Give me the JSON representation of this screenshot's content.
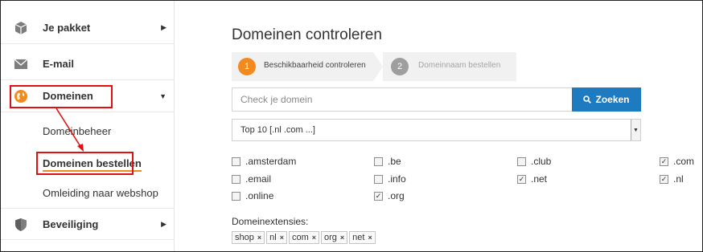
{
  "sidebar": {
    "items": [
      {
        "label": "Je pakket",
        "icon": "package-icon"
      },
      {
        "label": "E-mail",
        "icon": "envelope-icon"
      },
      {
        "label": "Domeinen",
        "icon": "globe-icon"
      },
      {
        "label": "Beveiliging",
        "icon": "shield-icon"
      }
    ],
    "sub_items": [
      {
        "label": "Domeinbeheer"
      },
      {
        "label": "Domeinen bestellen"
      },
      {
        "label": "Omleiding naar webshop"
      }
    ]
  },
  "main": {
    "title": "Domeinen controleren",
    "steps": [
      {
        "number": "1",
        "label": "Beschikbaarheid controleren",
        "state": "active"
      },
      {
        "number": "2",
        "label": "Domeinnaam bestellen",
        "state": "inactive"
      }
    ],
    "search": {
      "placeholder": "Check je domein",
      "value": "",
      "button_label": "Zoeken"
    },
    "select": {
      "value": "Top 10 [.nl .com ...]"
    },
    "tlds": [
      {
        "label": ".amsterdam",
        "checked": false
      },
      {
        "label": ".be",
        "checked": false
      },
      {
        "label": ".club",
        "checked": false
      },
      {
        "label": ".com",
        "checked": true
      },
      {
        "label": ".email",
        "checked": false
      },
      {
        "label": ".info",
        "checked": false
      },
      {
        "label": ".net",
        "checked": true
      },
      {
        "label": ".nl",
        "checked": true
      },
      {
        "label": ".online",
        "checked": false
      },
      {
        "label": ".org",
        "checked": true
      }
    ],
    "extensions_label": "Domeinextensies:",
    "chips": [
      "shop",
      "nl",
      "com",
      "org",
      "net"
    ]
  },
  "colors": {
    "accent_orange": "#f28a1e",
    "button_blue": "#1e7bc0",
    "annotation_red": "#e01010"
  }
}
